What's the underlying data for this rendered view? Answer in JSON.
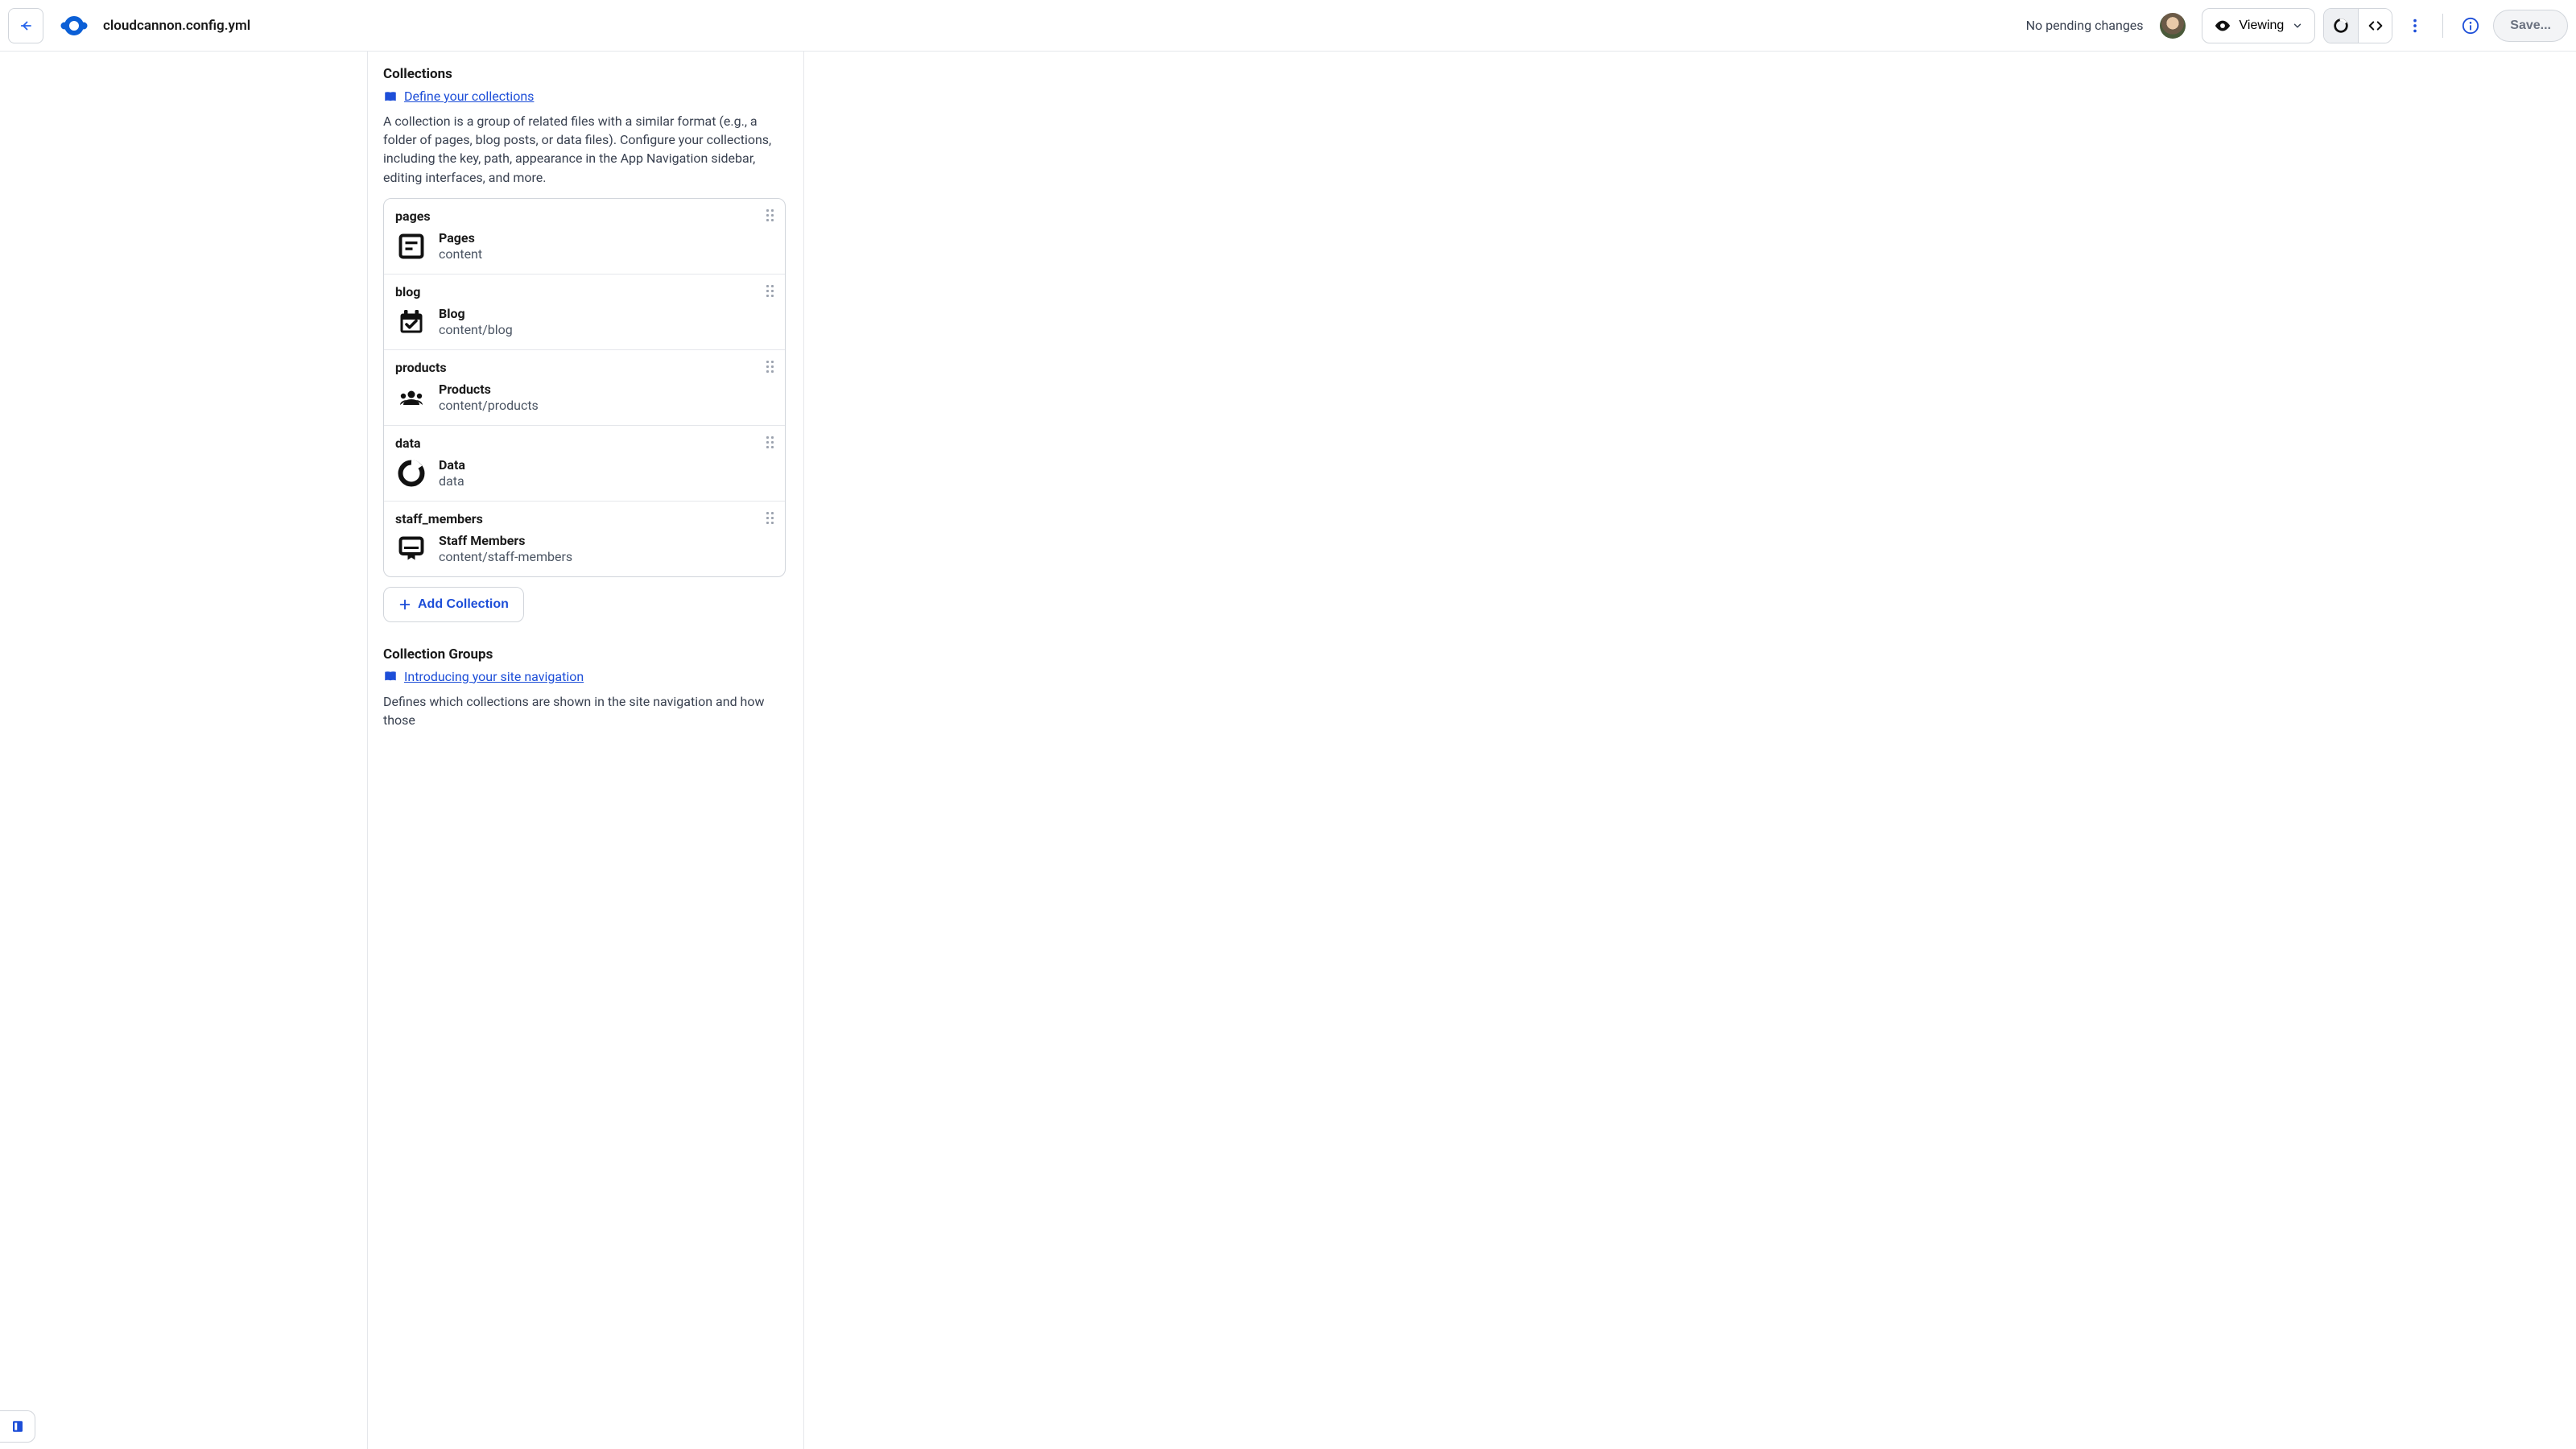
{
  "header": {
    "filename": "cloudcannon.config.yml",
    "pending": "No pending changes",
    "viewing_label": "Viewing",
    "save_label": "Save..."
  },
  "sections": {
    "collections": {
      "title": "Collections",
      "link_label": "Define your collections",
      "description": "A collection is a group of related files with a similar format (e.g., a folder of pages, blog posts, or data files). Configure your collections, including the key, path, appearance in the App Navigation sidebar, editing interfaces, and more.",
      "add_label": "Add Collection",
      "items": [
        {
          "key": "pages",
          "name": "Pages",
          "path": "content",
          "icon": "page"
        },
        {
          "key": "blog",
          "name": "Blog",
          "path": "content/blog",
          "icon": "calendar"
        },
        {
          "key": "products",
          "name": "Products",
          "path": "content/products",
          "icon": "people"
        },
        {
          "key": "data",
          "name": "Data",
          "path": "data",
          "icon": "donut"
        },
        {
          "key": "staff_members",
          "name": "Staff Members",
          "path": "content/staff-members",
          "icon": "badge"
        }
      ]
    },
    "collection_groups": {
      "title": "Collection Groups",
      "link_label": "Introducing your site navigation",
      "description": "Defines which collections are shown in the site navigation and how those"
    }
  }
}
